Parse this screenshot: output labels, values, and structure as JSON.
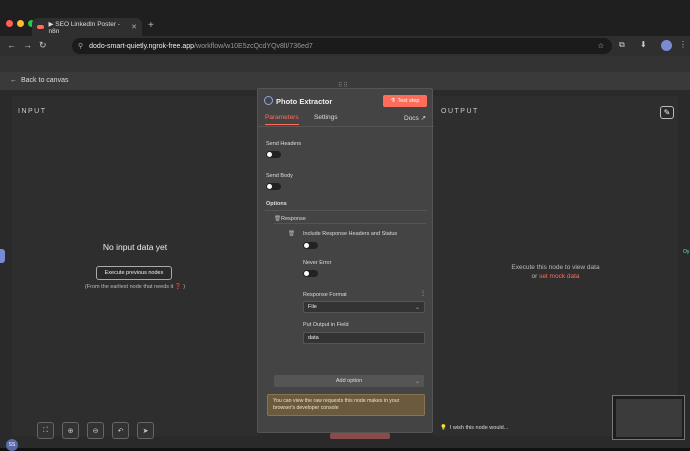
{
  "browser": {
    "tab_title": "▶ SEO LinkedIn Poster - n8n",
    "url_host": "dodo-smart-quietly.ngrok-free.app",
    "url_path": "/workflow/w10E5zcQcdYQv8lI/736ed7"
  },
  "app": {
    "back_label": "Back to canvas",
    "input": {
      "label": "INPUT",
      "empty_title": "No input data yet",
      "execute_previous": "Execute previous nodes",
      "hint": "(From the earliest node that needs it ❓ )"
    },
    "output": {
      "label": "OUTPUT",
      "message_line1": "Execute this node to view data",
      "message_or": "or",
      "mock_link": "set mock data"
    },
    "node": {
      "title": "Photo Extractor",
      "test_step": "Test step",
      "tabs": {
        "parameters": "Parameters",
        "settings": "Settings",
        "docs": "Docs ↗"
      },
      "send_headers": "Send Headers",
      "send_body": "Send Body",
      "options": "Options",
      "response_group": "Response",
      "include_response": "Include Response Headers and Status",
      "never_error": "Never Error",
      "response_format_label": "Response Format",
      "response_format_value": "File",
      "put_output_label": "Put Output in Field",
      "put_output_value": "data",
      "add_option": "Add option",
      "notice": "You can view the raw requests this node makes in your browser's developer console"
    },
    "wish": "I wish this node would...",
    "avatar_initials": "SS",
    "right_badge": "Oy"
  },
  "colors": {
    "accent": "#ff6d5a",
    "notice_bg": "#6b5a3e"
  }
}
